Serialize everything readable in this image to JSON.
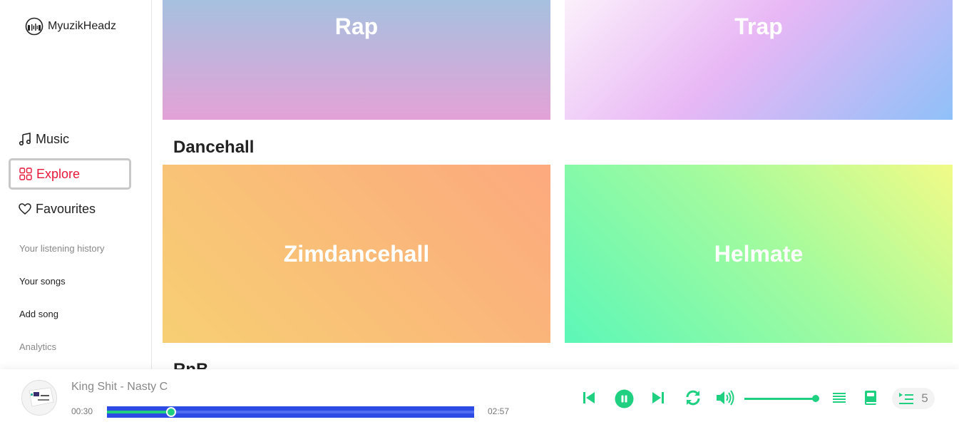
{
  "app": {
    "brand": "MyuzikHeadz"
  },
  "sidebar": {
    "nav": [
      {
        "label": "Music",
        "icon": "music-note-icon"
      },
      {
        "label": "Explore",
        "icon": "grid-icon",
        "active": true
      },
      {
        "label": "Favourites",
        "icon": "heart-icon"
      }
    ],
    "links": [
      {
        "label": "Your listening history"
      },
      {
        "label": "Your songs"
      },
      {
        "label": "Add song"
      },
      {
        "label": "Analytics"
      }
    ]
  },
  "main": {
    "top_cards": [
      {
        "label": "Rap"
      },
      {
        "label": "Trap"
      }
    ],
    "sections": [
      {
        "title": "Dancehall",
        "cards": [
          {
            "label": "Zimdancehall"
          },
          {
            "label": "Helmate"
          }
        ]
      },
      {
        "title": "RnB"
      }
    ]
  },
  "player": {
    "track": "King Shit - Nasty C",
    "elapsed": "00:30",
    "duration": "02:57",
    "progress_fraction": 0.175,
    "volume_fraction": 0.95,
    "queue_count": "5",
    "accent_color": "#1ed07f"
  }
}
